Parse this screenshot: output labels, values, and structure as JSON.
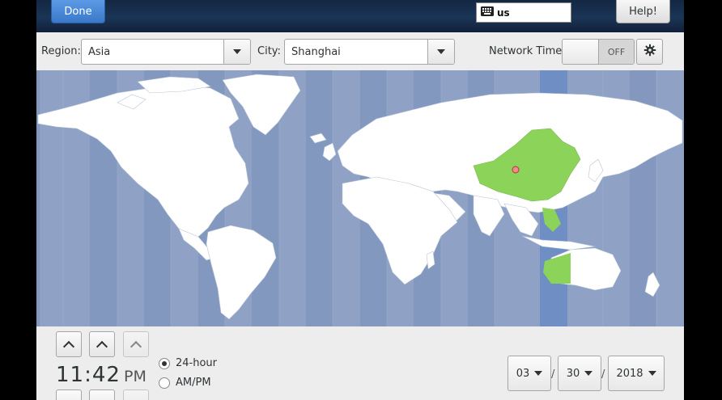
{
  "header": {
    "done_label": "Done",
    "keyboard_layout": "us",
    "help_label": "Help!"
  },
  "toolbar": {
    "region_label": "Region:",
    "region_value": "Asia",
    "city_label": "City:",
    "city_value": "Shanghai",
    "network_time_label": "Network Time",
    "network_time_state": "OFF"
  },
  "map": {
    "selected_timezone_color": "#8cd35a",
    "selected_band_color": "#6f8fc4",
    "land_color": "#ffffff",
    "ocean_color": "#8fa2c6",
    "marker_color": "#f08a8a"
  },
  "time": {
    "hours": "11",
    "minutes": "42",
    "separator": ":",
    "meridiem": "PM",
    "format_24h_label": "24-hour",
    "format_ampm_label": "AM/PM",
    "selected_format": "24-hour"
  },
  "date": {
    "month": "03",
    "day": "30",
    "year": "2018",
    "separator": "/"
  }
}
